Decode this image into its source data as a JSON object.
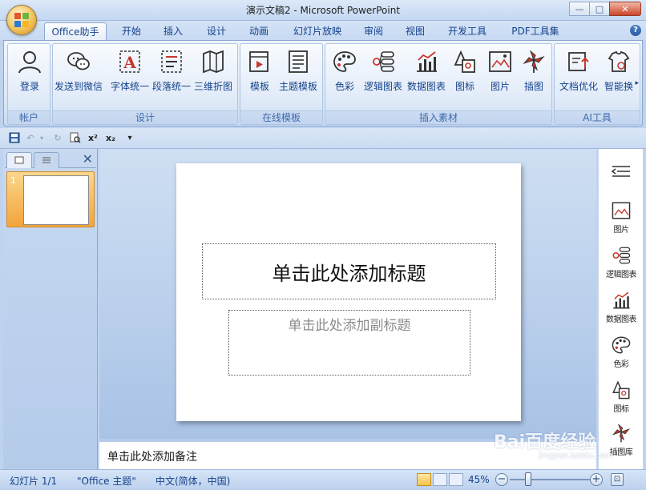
{
  "window": {
    "title": "演示文稿2 - Microsoft PowerPoint",
    "minimize": "—",
    "maximize": "□",
    "close": "✕"
  },
  "tabs": [
    {
      "label": "Office助手",
      "active": true
    },
    {
      "label": "开始"
    },
    {
      "label": "插入"
    },
    {
      "label": "设计"
    },
    {
      "label": "动画"
    },
    {
      "label": "幻灯片放映"
    },
    {
      "label": "审阅"
    },
    {
      "label": "视图"
    },
    {
      "label": "开发工具"
    },
    {
      "label": "PDF工具集"
    }
  ],
  "ribbon": {
    "groups": [
      {
        "label": "帐户",
        "buttons": [
          {
            "label": "登录",
            "icon": "user-icon"
          }
        ]
      },
      {
        "label": "设计",
        "buttons": [
          {
            "label": "发送到微信",
            "icon": "wechat-icon"
          },
          {
            "label": "字体统一",
            "icon": "font-icon"
          },
          {
            "label": "段落统一",
            "icon": "paragraph-icon"
          },
          {
            "label": "三维折图",
            "icon": "fold-map-icon"
          }
        ]
      },
      {
        "label": "在线模板",
        "buttons": [
          {
            "label": "模板",
            "icon": "template-icon"
          },
          {
            "label": "主题模板",
            "icon": "theme-template-icon"
          }
        ]
      },
      {
        "label": "插入素材",
        "buttons": [
          {
            "label": "色彩",
            "icon": "palette-icon"
          },
          {
            "label": "逻辑图表",
            "icon": "logic-chart-icon"
          },
          {
            "label": "数据图表",
            "icon": "data-chart-icon"
          },
          {
            "label": "图标",
            "icon": "shapes-icon"
          },
          {
            "label": "图片",
            "icon": "picture-icon"
          },
          {
            "label": "插图",
            "icon": "illustration-icon"
          }
        ]
      },
      {
        "label": "AI工具",
        "buttons": [
          {
            "label": "文档优化",
            "icon": "doc-optimize-icon"
          },
          {
            "label": "智能换",
            "icon": "smart-change-icon"
          }
        ]
      }
    ]
  },
  "qat": {
    "superscript": "x²",
    "subscript": "x₂",
    "customize": "▾"
  },
  "thumbs": {
    "slide_number": "1",
    "close": "✕"
  },
  "slide": {
    "title_placeholder": "单击此处添加标题",
    "subtitle_placeholder": "单击此处添加副标题"
  },
  "notes": {
    "placeholder": "单击此处添加备注"
  },
  "sidebar": [
    {
      "label": "图片",
      "icon": "picture-icon"
    },
    {
      "label": "逻辑图表",
      "icon": "logic-chart-icon"
    },
    {
      "label": "数据图表",
      "icon": "data-chart-icon"
    },
    {
      "label": "色彩",
      "icon": "palette-icon"
    },
    {
      "label": "图标",
      "icon": "shapes-icon"
    },
    {
      "label": "插图库",
      "icon": "illustration-icon"
    }
  ],
  "status": {
    "slide_info": "幻灯片 1/1",
    "theme": "\"Office 主题\"",
    "language": "中文(简体，中国)",
    "zoom": "45%",
    "zoom_level": 0.45,
    "minus": "−",
    "plus": "+"
  },
  "watermark": {
    "text": "Bai百度经验",
    "sub": "jingyan.baidu.com"
  },
  "colors": {
    "accent": "#15428b",
    "ribbon_bg": "#dbe7f7",
    "workspace": "#bfd3ef",
    "thumb_highlight": "#f3a43a"
  }
}
